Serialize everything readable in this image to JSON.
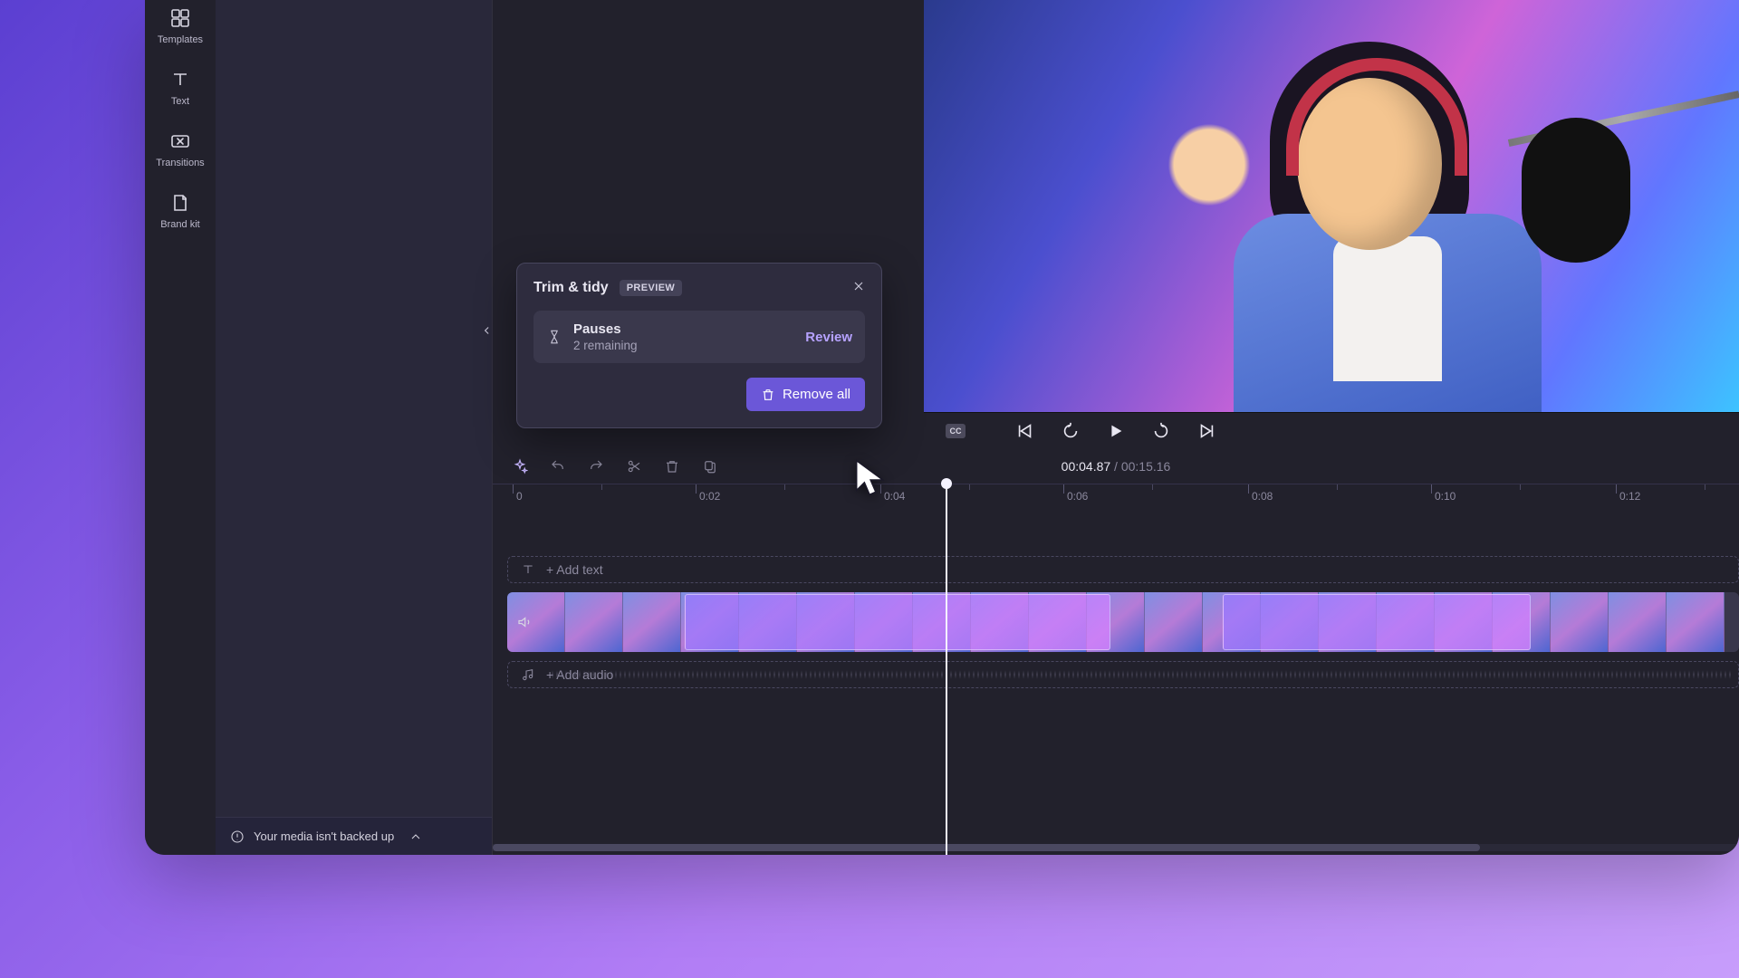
{
  "rail": {
    "templates": "Templates",
    "text": "Text",
    "transitions": "Transitions",
    "brand_kit": "Brand kit"
  },
  "backup_notice": "Your media isn't backed up",
  "popover": {
    "title": "Trim & tidy",
    "badge": "PREVIEW",
    "pauses_title": "Pauses",
    "pauses_sub": "2 remaining",
    "review": "Review",
    "remove_all": "Remove all"
  },
  "playback": {
    "cc": "CC",
    "time_current": "00:04.87",
    "time_sep": " / ",
    "time_total": "00:15.16"
  },
  "ruler": {
    "t0": "0",
    "t02": "0:02",
    "t04": "0:04",
    "t06": "0:06",
    "t08": "0:08",
    "t10": "0:10",
    "t12": "0:12"
  },
  "tracks": {
    "add_text": "+ Add text",
    "add_audio": "+ Add audio"
  }
}
